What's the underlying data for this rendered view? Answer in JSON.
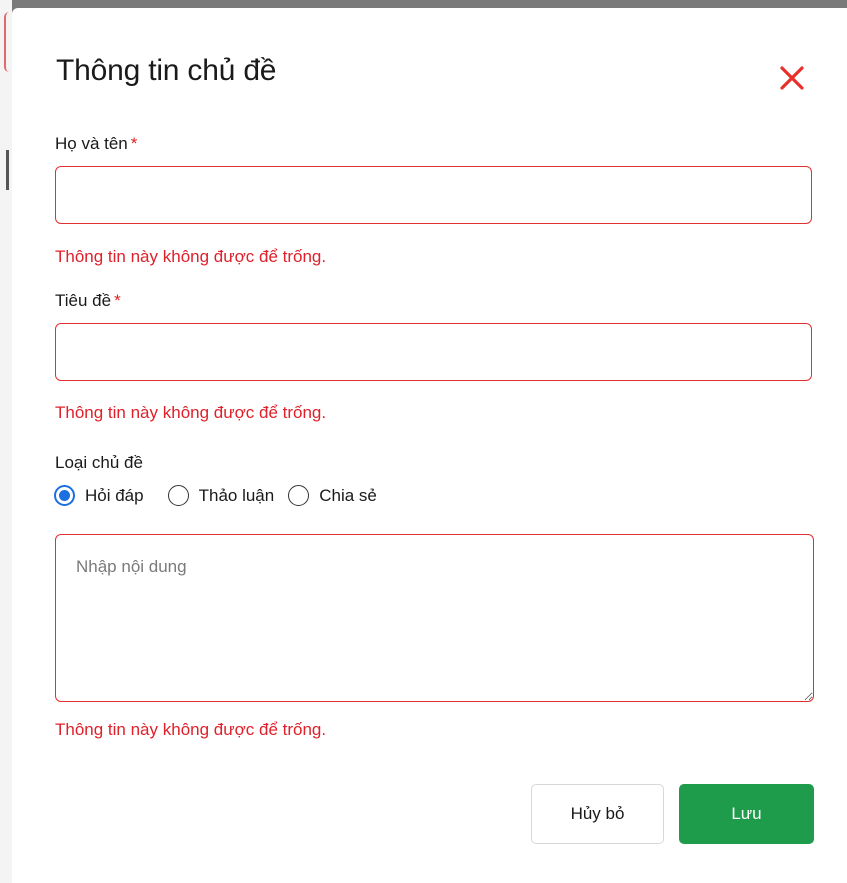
{
  "modal": {
    "title": "Thông tin chủ đề",
    "close_icon": "close-icon"
  },
  "fields": {
    "full_name": {
      "label": "Họ và tên",
      "required_mark": "*",
      "value": "",
      "error": "Thông tin này không được để trống."
    },
    "subject": {
      "label": "Tiêu đề",
      "required_mark": "*",
      "value": "",
      "error": "Thông tin này không được để trống."
    },
    "topic_type": {
      "label": "Loại chủ đề",
      "options": [
        "Hỏi đáp",
        "Thảo luận",
        "Chia sẻ"
      ],
      "selected": "Hỏi đáp"
    },
    "content": {
      "placeholder": "Nhập nội dung",
      "value": "",
      "error": "Thông tin này không được để trống."
    }
  },
  "actions": {
    "cancel_label": "Hủy bỏ",
    "save_label": "Lưu"
  },
  "colors": {
    "error": "#e0202a",
    "required": "#e02020",
    "radio_selected": "#1b6fe0",
    "save_button": "#1f9b4c",
    "close_icon": "#e8302a"
  }
}
